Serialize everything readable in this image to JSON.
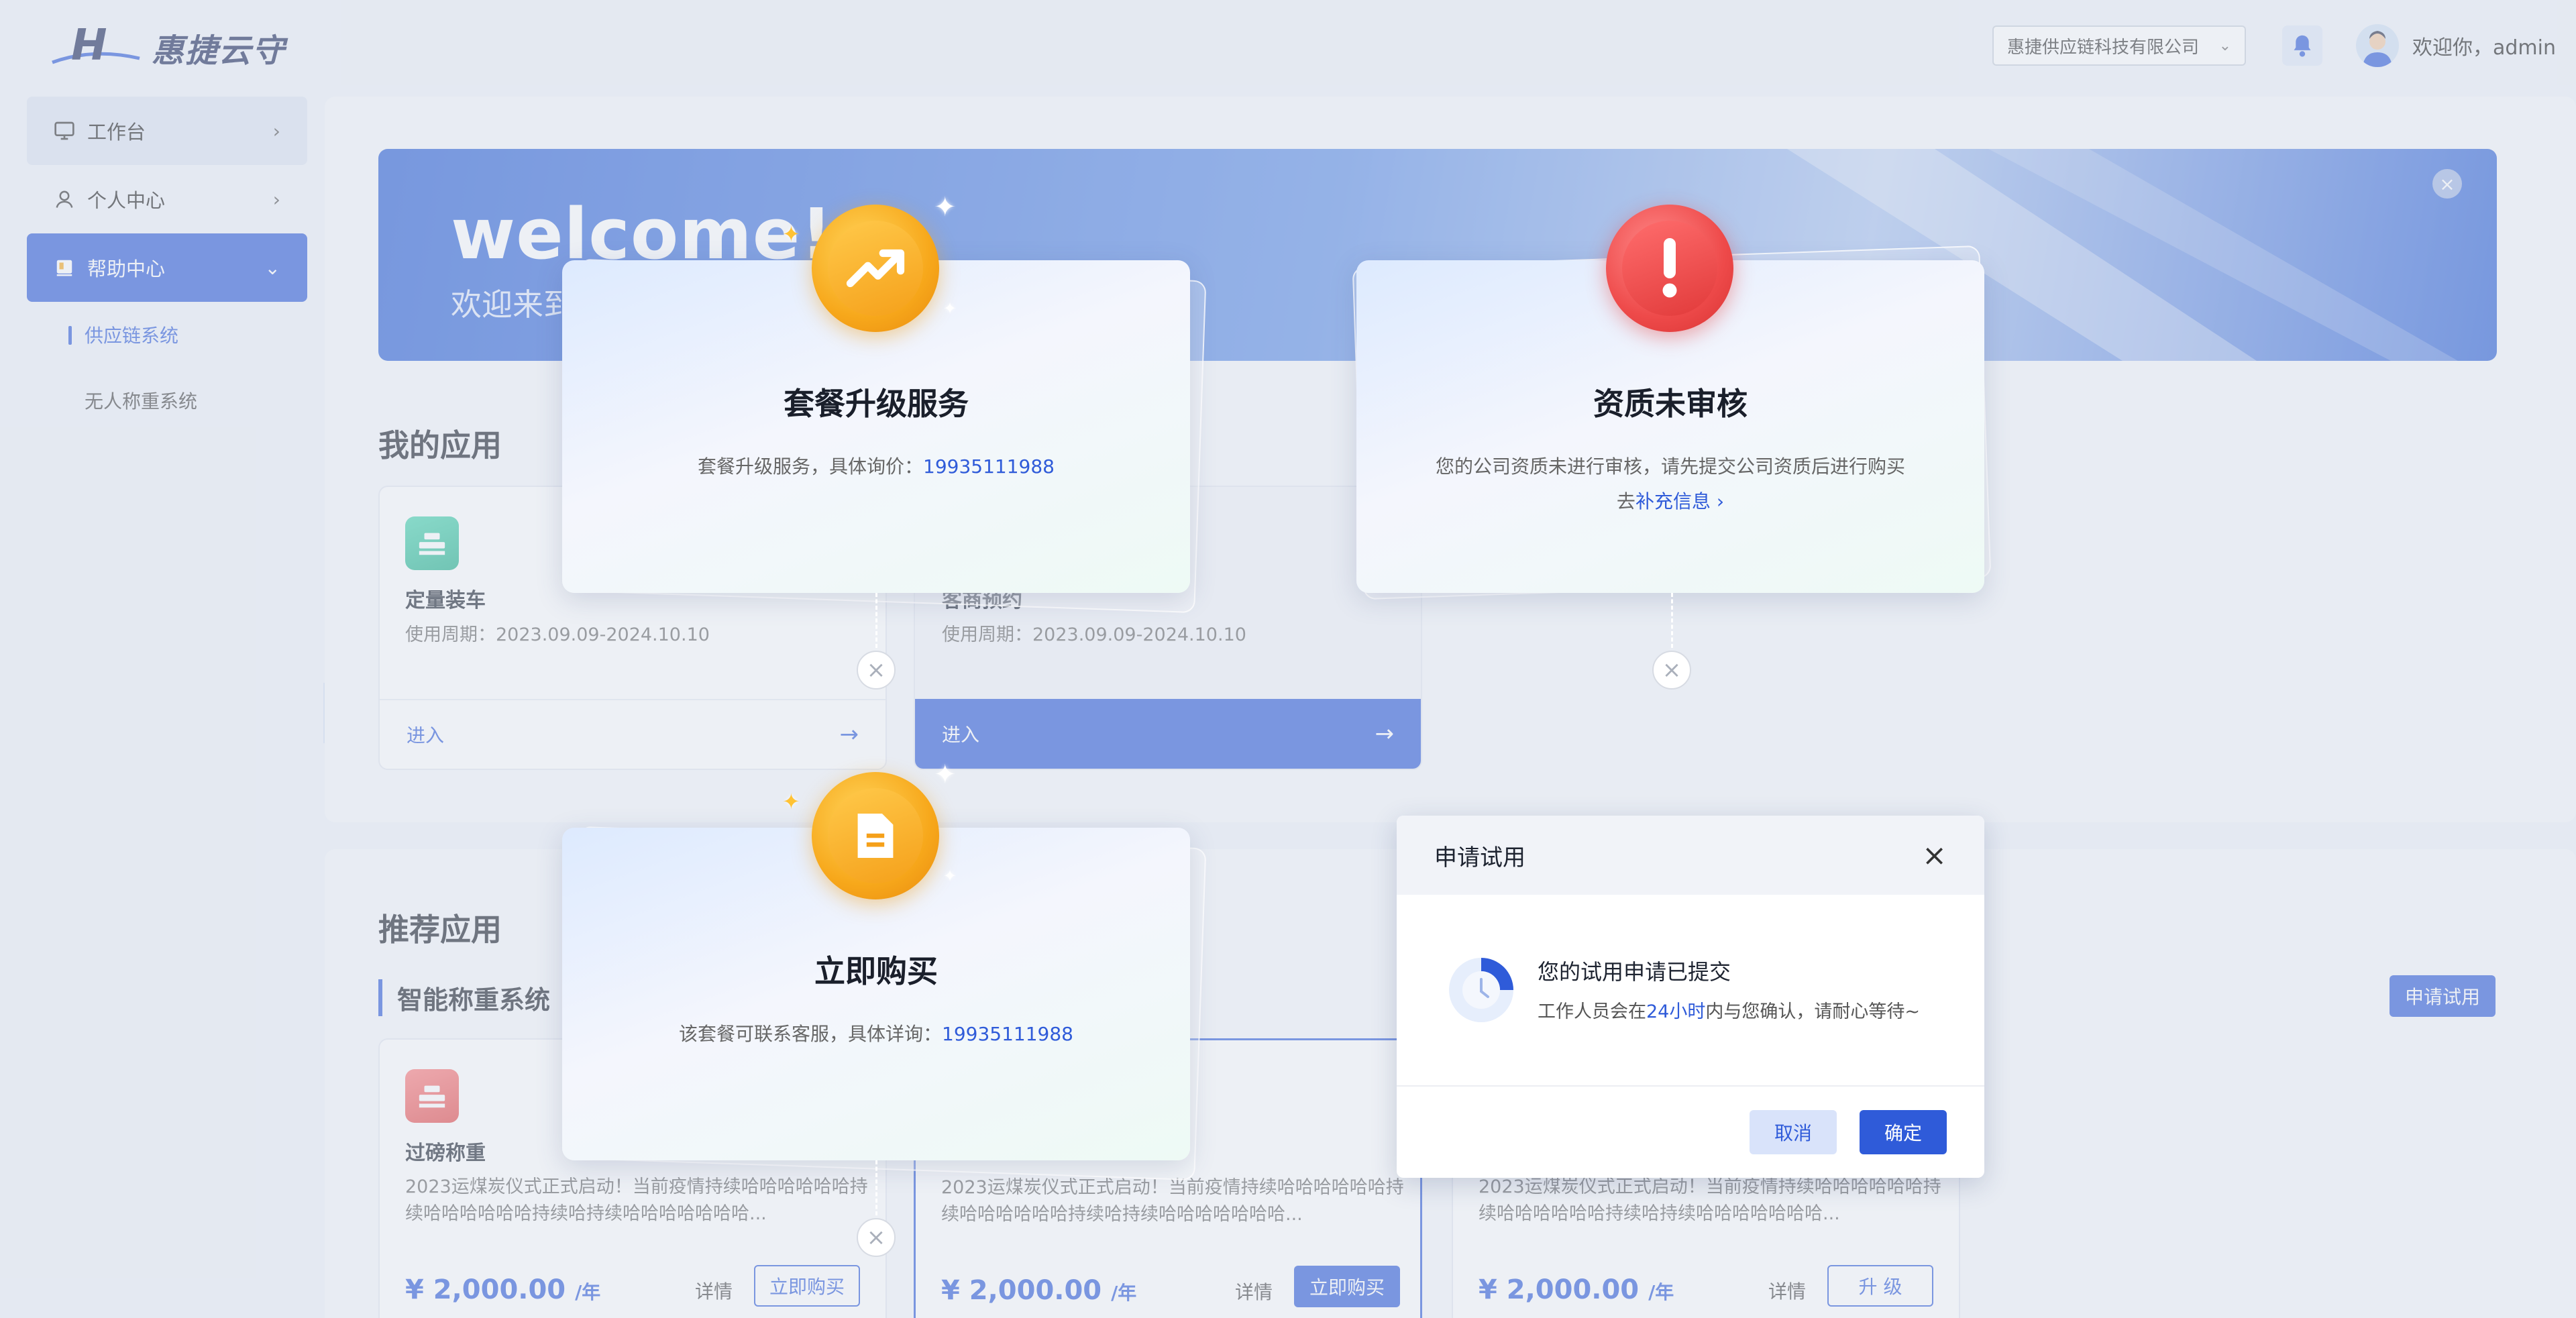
{
  "header": {
    "logo_text": "惠捷云守",
    "company_select": "惠捷供应链科技有限公司",
    "welcome_user": "欢迎你，admin"
  },
  "sidebar": {
    "items": [
      {
        "label": "工作台"
      },
      {
        "label": "个人中心"
      },
      {
        "label": "帮助中心"
      }
    ],
    "sub_items": [
      {
        "label": "供应链系统"
      },
      {
        "label": "无人称重系统"
      }
    ],
    "collapse_label": "»"
  },
  "banner": {
    "title": "welcome!",
    "subtitle": "欢迎来到"
  },
  "my_apps": {
    "title": "我的应用",
    "cards": [
      {
        "name": "定量装车",
        "period": "使用周期：2023.09.09-2024.10.10",
        "enter": "进入"
      },
      {
        "name": "客商预约",
        "period": "使用周期：2023.09.09-2024.10.10",
        "enter": "进入"
      }
    ]
  },
  "recommend": {
    "title": "推荐应用",
    "subtitle": "智能称重系统",
    "apply_button": "申请试用",
    "cards": [
      {
        "name": "过磅称重",
        "desc": "2023运煤炭仪式正式启动！当前疫情持续哈哈哈哈哈哈持续哈哈哈哈哈哈持续哈持续哈哈哈哈哈哈哈...",
        "price": "¥ 2,000.00",
        "unit": "/年",
        "detail": "详情",
        "action": "立即购买"
      },
      {
        "name": "",
        "desc": "2023运煤炭仪式正式启动！当前疫情持续哈哈哈哈哈哈持续哈哈哈哈哈哈持续哈持续哈哈哈哈哈哈哈...",
        "price": "¥ 2,000.00",
        "unit": "/年",
        "detail": "详情",
        "action": "立即购买"
      },
      {
        "name": "",
        "desc": "2023运煤炭仪式正式启动！当前疫情持续哈哈哈哈哈哈持续哈哈哈哈哈哈持续哈持续哈哈哈哈哈哈哈...",
        "price": "¥ 2,000.00",
        "unit": "/年",
        "detail": "详情",
        "action": "升 级"
      }
    ]
  },
  "promos": [
    {
      "title": "套餐升级服务",
      "text": "套餐升级服务，具体询价：",
      "phone": "19935111988"
    },
    {
      "title": "资质未审核",
      "text": "您的公司资质未进行审核，请先提交公司资质后进行购买",
      "link_prefix": "去",
      "link": "补充信息",
      "link_arrow": "›"
    },
    {
      "title": "立即购买",
      "text": "该套餐可联系客服，具体详询：",
      "phone": "19935111988"
    }
  ],
  "dialog": {
    "title": "申请试用",
    "heading": "您的试用申请已提交",
    "line_prefix": "工作人员会在",
    "line_highlight": "24小时",
    "line_suffix": "内与您确认，请耐心等待~",
    "cancel": "取消",
    "ok": "确定"
  },
  "colors": {
    "primary": "#2f5bd9",
    "gold": "#f7a81b",
    "red": "#ee4a4a"
  }
}
